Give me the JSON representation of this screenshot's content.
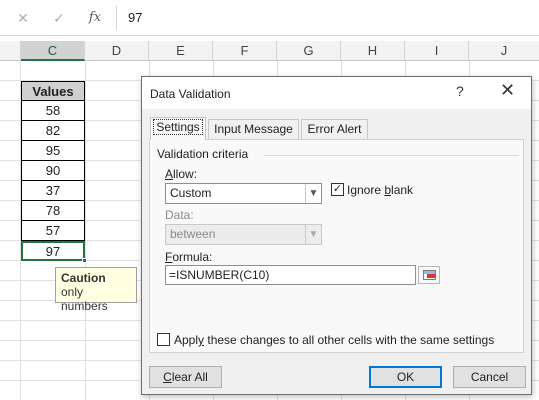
{
  "formula_bar": {
    "cancel_glyph": "✕",
    "enter_glyph": "✓",
    "fx_label": "fx",
    "value": "97"
  },
  "columns": [
    "C",
    "D",
    "E",
    "F",
    "G",
    "H",
    "I",
    "J"
  ],
  "selected_column": "C",
  "cells": {
    "header": "Values",
    "values": [
      "58",
      "82",
      "95",
      "90",
      "37",
      "78",
      "57",
      "97"
    ]
  },
  "input_message": {
    "title": "Caution",
    "text": "only numbers"
  },
  "dialog": {
    "title": "Data Validation",
    "help_glyph": "?",
    "close_glyph": "✕",
    "tabs": [
      "Settings",
      "Input Message",
      "Error Alert"
    ],
    "active_tab": "Settings",
    "group_label": "Validation criteria",
    "allow_label": "Allow:",
    "allow_value": "Custom",
    "ignore_blank_label": "Ignore blank",
    "ignore_blank_checked": true,
    "data_label": "Data:",
    "data_value": "between",
    "formula_label": "Formula:",
    "formula_value": "=ISNUMBER(C10)",
    "apply_label": "Apply these changes to all other cells with the same settings",
    "apply_checked": false,
    "buttons": {
      "clear_all": "Clear All",
      "ok": "OK",
      "cancel": "Cancel"
    }
  },
  "colors": {
    "excel_green": "#217346",
    "ok_border": "#0078d7",
    "tooltip_bg": "#ffffe1"
  }
}
